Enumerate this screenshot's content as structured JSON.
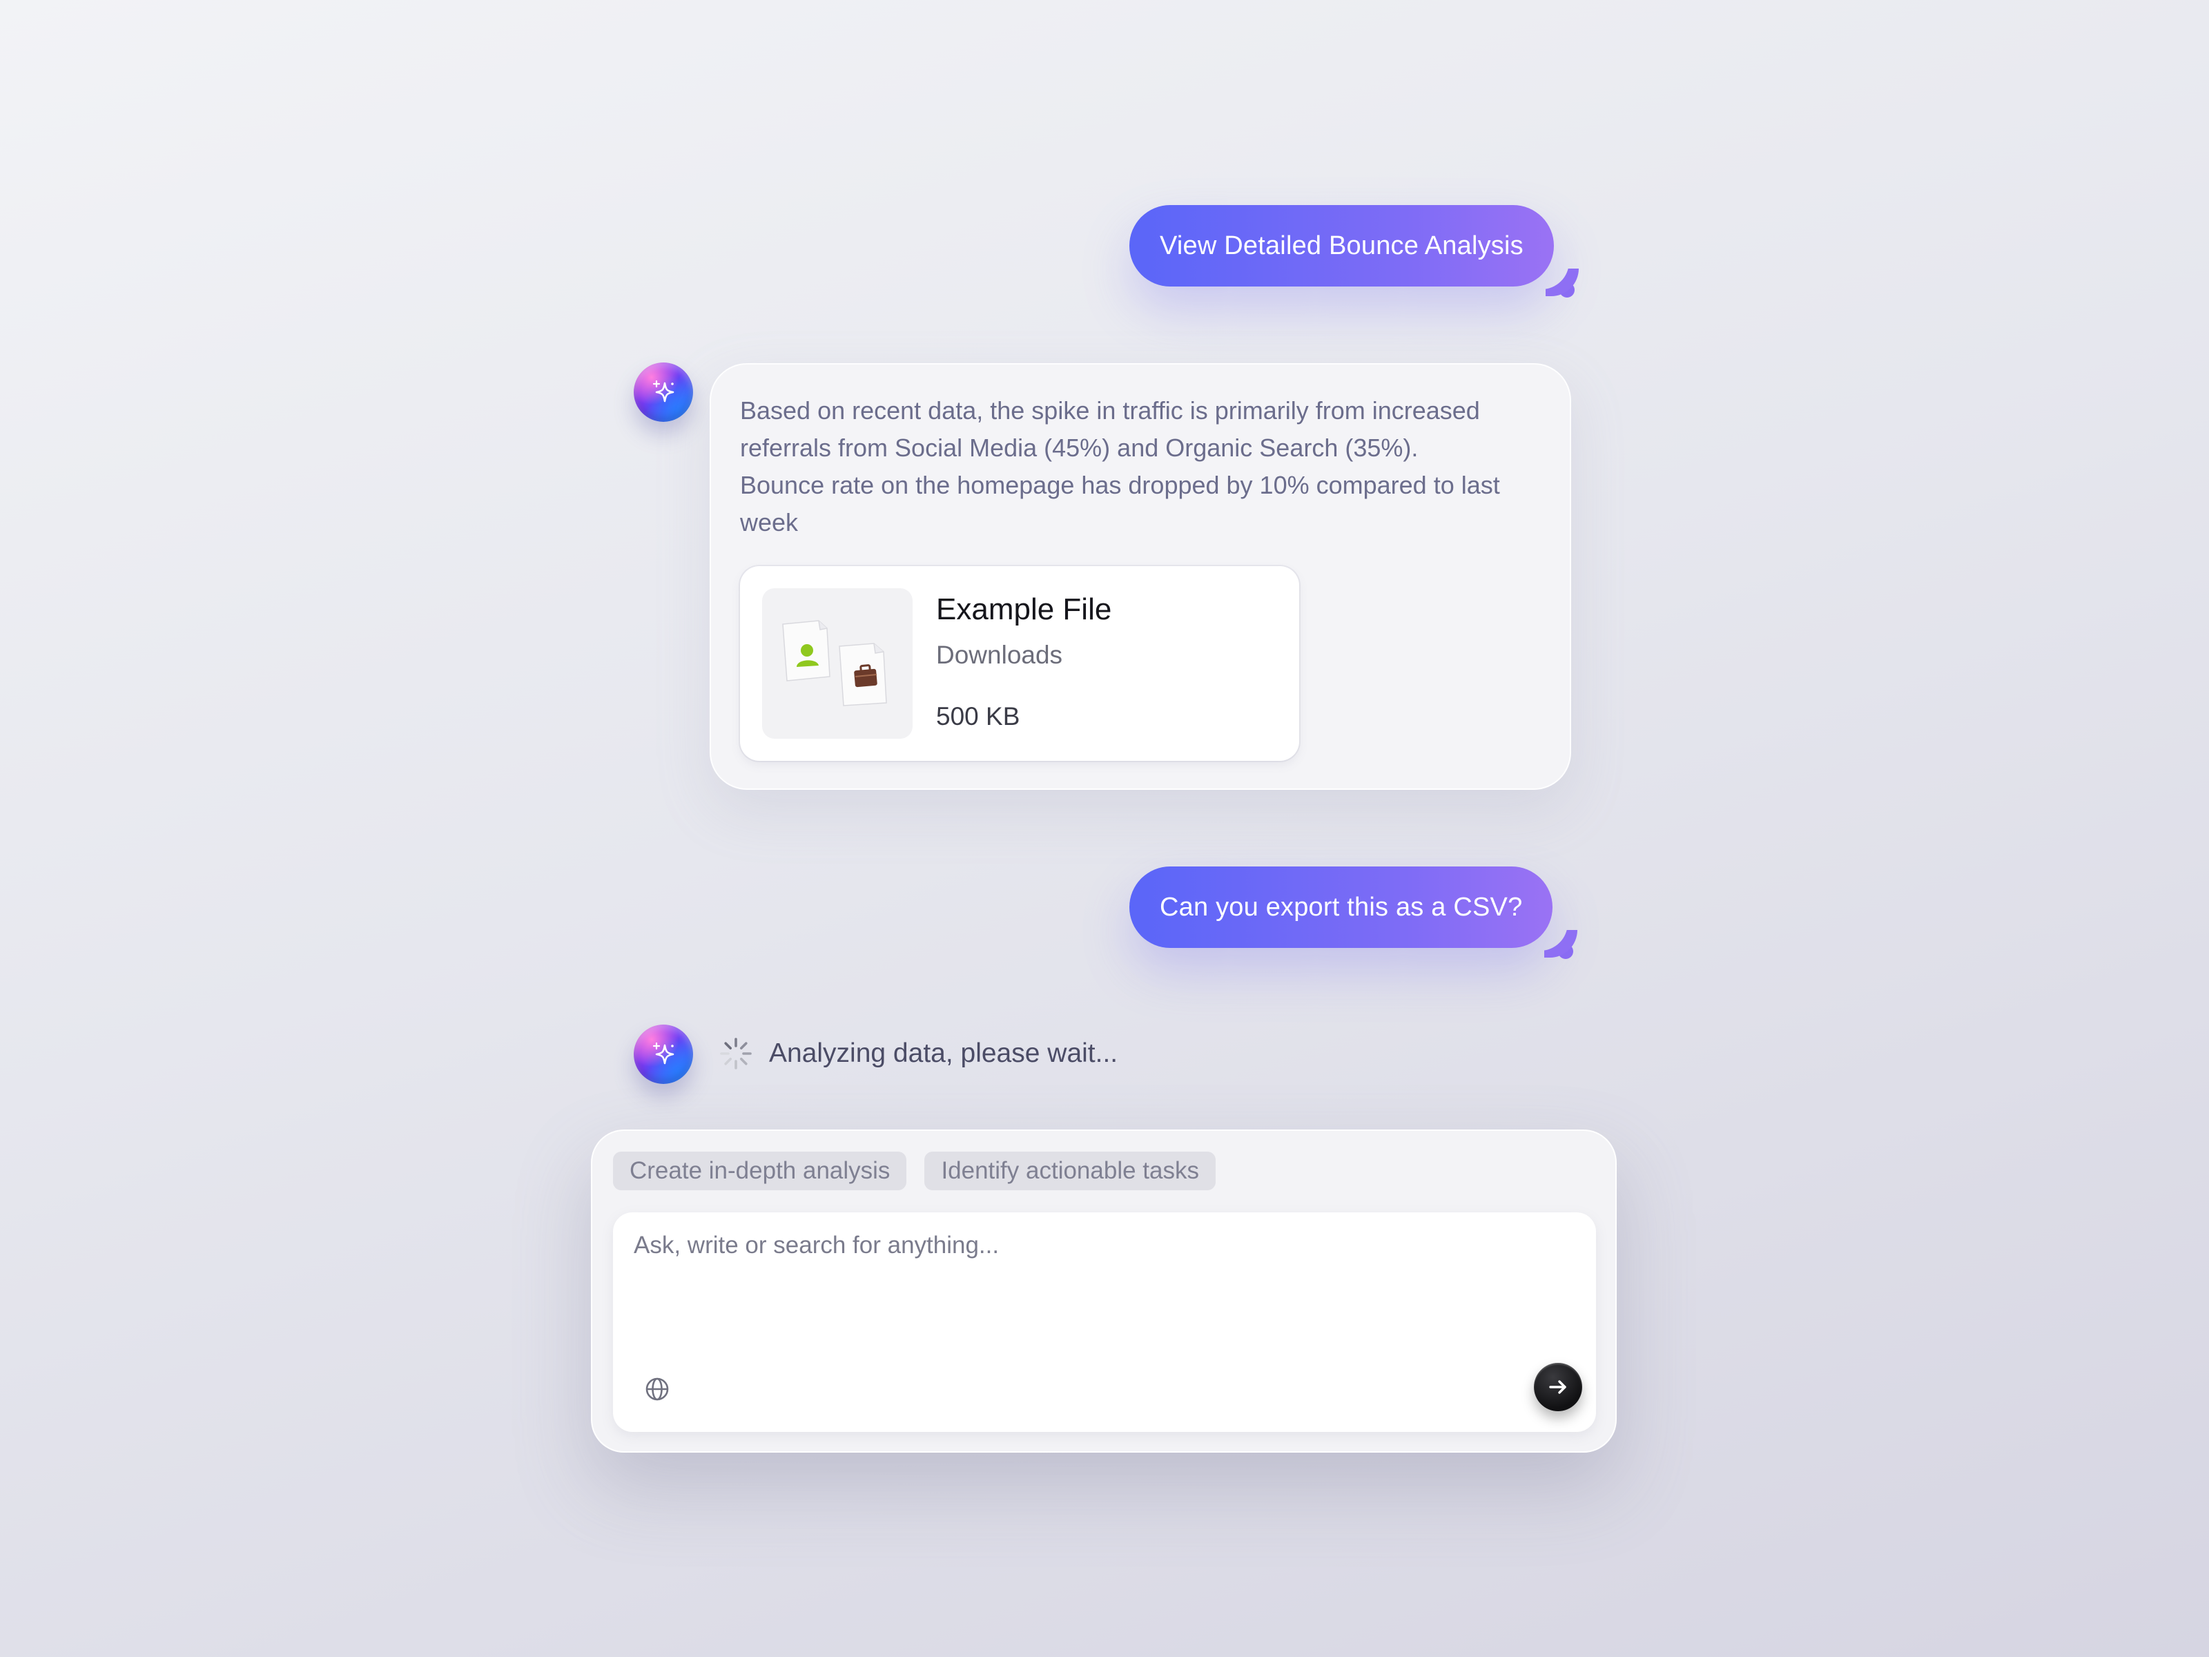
{
  "conversation": {
    "user_message_1": "View Detailed Bounce Analysis",
    "assistant_message": {
      "lines": [
        "Based on recent data, the spike in traffic is primarily from increased",
        "referrals from Social Media (45%) and Organic Search (35%).",
        "Bounce rate on the homepage has dropped by 10% compared to last",
        "week"
      ],
      "attachment": {
        "name": "Example File",
        "location": "Downloads",
        "size": "500 KB",
        "icons": [
          "user-document-icon",
          "briefcase-document-icon"
        ]
      }
    },
    "user_message_2": "Can you export this as a CSV?",
    "status": {
      "text": "Analyzing data, please wait...",
      "icon": "spinner-icon"
    }
  },
  "composer": {
    "suggestions": [
      "Create in-depth analysis",
      "Identify actionable tasks"
    ],
    "input": {
      "placeholder": "Ask, write or search for anything...",
      "value": ""
    },
    "icons": {
      "web": "globe-icon",
      "send": "arrow-right-icon"
    }
  },
  "colors": {
    "user_bubble_start": "#5a66f8",
    "user_bubble_end": "#9a72f4",
    "assistant_text": "#6b6d8c",
    "send_button": "#111113"
  }
}
